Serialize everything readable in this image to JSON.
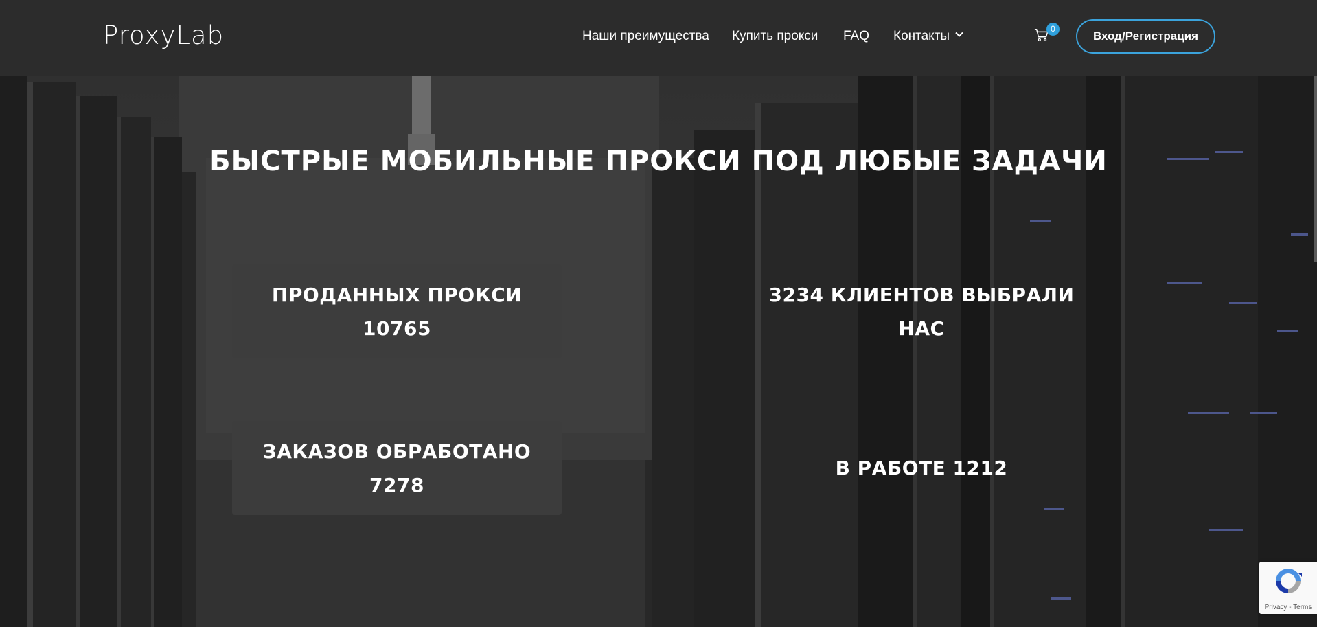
{
  "header": {
    "logo": "ProxyLab",
    "nav": [
      {
        "label": "Наши преимущества"
      },
      {
        "label": "Купить прокси"
      },
      {
        "label": "FAQ"
      },
      {
        "label": "Контакты"
      }
    ],
    "cart_count": "0",
    "login_label": "Вход/Регистрация",
    "icons": {
      "cart": "cart-icon",
      "dropdown": "chevron-down-icon"
    }
  },
  "hero": {
    "title": "БЫСТРЫЕ МОБИЛЬНЫЕ ПРОКСИ ПОД ЛЮБЫЕ ЗАДАЧИ",
    "stats": [
      {
        "line1": "ПРОДАННЫХ ПРОКСИ",
        "line2": "10765"
      },
      {
        "line1": "3234 КЛИЕНТОВ ВЫБРАЛИ",
        "line2": "НАС"
      },
      {
        "line1": "ЗАКАЗОВ ОБРАБОТАНО",
        "line2": "7278"
      },
      {
        "line1": "В РАБОТЕ 1212",
        "line2": ""
      }
    ]
  },
  "recaptcha": {
    "privacy": "Privacy",
    "separator": " - ",
    "terms": "Terms"
  },
  "colors": {
    "accent": "#3ba3dc",
    "header_bg": "#2c2c2c",
    "box_bg": "#3e3e3e"
  }
}
